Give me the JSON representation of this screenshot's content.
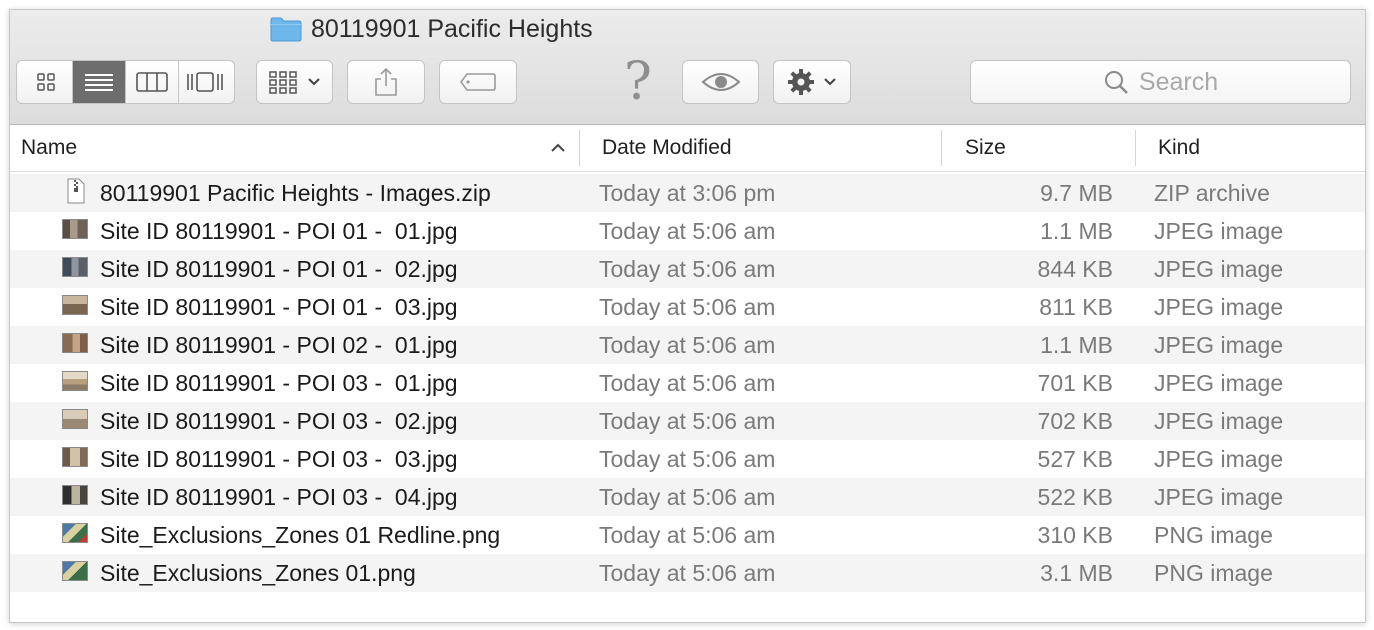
{
  "window": {
    "title": "80119901 Pacific Heights"
  },
  "toolbar": {
    "view_modes": [
      "icon-view",
      "list-view",
      "column-view",
      "cover-flow-view"
    ],
    "active_view": "list-view",
    "help_glyph": "?"
  },
  "search": {
    "placeholder": "Search"
  },
  "columns": {
    "name": "Name",
    "date": "Date Modified",
    "size": "Size",
    "kind": "Kind",
    "sort_glyph": "^"
  },
  "files": [
    {
      "name": "80119901 Pacific Heights - Images.zip",
      "date": "Today at 3:06 pm",
      "size": "9.7 MB",
      "kind": "ZIP archive",
      "icon": "zip-file-icon"
    },
    {
      "name": "Site ID 80119901 - POI 01 -  01.jpg",
      "date": "Today at 5:06 am",
      "size": "1.1 MB",
      "kind": "JPEG image",
      "icon": "jpeg-thumbnail-icon"
    },
    {
      "name": "Site ID 80119901 - POI 01 -  02.jpg",
      "date": "Today at 5:06 am",
      "size": "844 KB",
      "kind": "JPEG image",
      "icon": "jpeg-thumbnail-icon"
    },
    {
      "name": "Site ID 80119901 - POI 01 -  03.jpg",
      "date": "Today at 5:06 am",
      "size": "811 KB",
      "kind": "JPEG image",
      "icon": "jpeg-thumbnail-icon"
    },
    {
      "name": "Site ID 80119901 - POI 02 -  01.jpg",
      "date": "Today at 5:06 am",
      "size": "1.1 MB",
      "kind": "JPEG image",
      "icon": "jpeg-thumbnail-icon"
    },
    {
      "name": "Site ID 80119901 - POI 03 -  01.jpg",
      "date": "Today at 5:06 am",
      "size": "701 KB",
      "kind": "JPEG image",
      "icon": "jpeg-thumbnail-icon"
    },
    {
      "name": "Site ID 80119901 - POI 03 -  02.jpg",
      "date": "Today at 5:06 am",
      "size": "702 KB",
      "kind": "JPEG image",
      "icon": "jpeg-thumbnail-icon"
    },
    {
      "name": "Site ID 80119901 - POI 03 -  03.jpg",
      "date": "Today at 5:06 am",
      "size": "527 KB",
      "kind": "JPEG image",
      "icon": "jpeg-thumbnail-icon"
    },
    {
      "name": "Site ID 80119901 - POI 03 -  04.jpg",
      "date": "Today at 5:06 am",
      "size": "522 KB",
      "kind": "JPEG image",
      "icon": "jpeg-thumbnail-icon"
    },
    {
      "name": "Site_Exclusions_Zones 01 Redline.png",
      "date": "Today at 5:06 am",
      "size": "310 KB",
      "kind": "PNG image",
      "icon": "png-thumbnail-icon"
    },
    {
      "name": "Site_Exclusions_Zones 01.png",
      "date": "Today at 5:06 am",
      "size": "3.1 MB",
      "kind": "PNG image",
      "icon": "png-thumbnail-icon"
    }
  ]
}
